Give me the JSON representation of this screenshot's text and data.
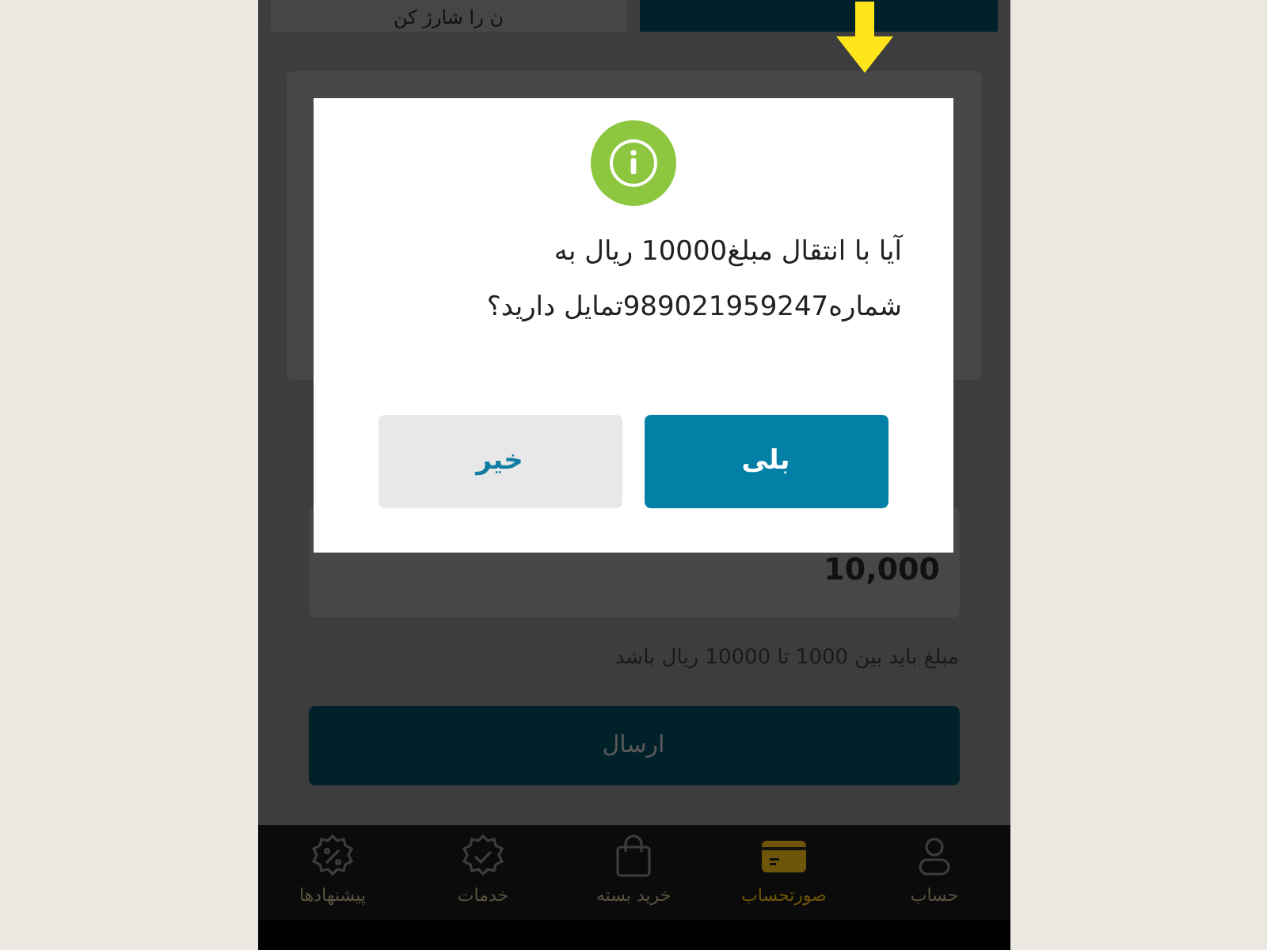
{
  "tabs": [
    {
      "selected": true
    },
    {
      "label": "ن را شارژ کن",
      "selected": false
    }
  ],
  "amount_field": {
    "value": "10,000"
  },
  "hint": "مبلغ باید بین 1000 تا 10000 ریال باشد",
  "send_button": "ارسال",
  "dialog": {
    "message": "آیا با انتقال مبلغ10000 ریال به شماره989021959247تمایل دارید؟",
    "buttons": [
      {
        "label": "بلی",
        "kind": "primary"
      },
      {
        "label": "خیر",
        "kind": "secondary"
      }
    ]
  },
  "bottom_nav": [
    {
      "label": "حساب",
      "selected": false
    },
    {
      "label": "صورتحساب",
      "selected": true
    },
    {
      "label": "خرید بسته",
      "selected": false
    },
    {
      "label": "خدمات",
      "selected": false
    },
    {
      "label": "پیشنهادها",
      "selected": false
    }
  ]
}
